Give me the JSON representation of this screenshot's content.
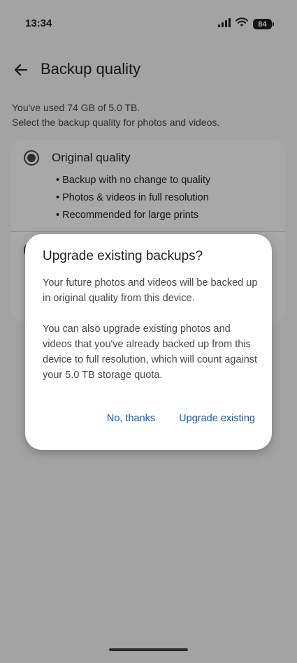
{
  "status_bar": {
    "time": "13:34",
    "battery": "84",
    "icons": [
      "signal-icon",
      "wifi-icon",
      "battery-icon"
    ]
  },
  "app_bar": {
    "title": "Backup quality",
    "back_icon": "arrow-back-icon"
  },
  "usage": {
    "line1": "You've used 74 GB of 5.0 TB.",
    "line2": "Select the backup quality for photos and videos."
  },
  "options": [
    {
      "title": "Original quality",
      "selected": true,
      "bullets": [
        "Backup with no change to quality",
        "Photos & videos in full resolution",
        "Recommended for large prints"
      ]
    }
  ],
  "dialog": {
    "title": "Upgrade existing backups?",
    "paragraph1": "Your future photos and videos will be backed up in original quality from this device.",
    "paragraph2": "You can also upgrade existing photos and videos that you've already backed up from this device to full resolution, which will count against your 5.0 TB storage quota.",
    "dismiss_label": "No, thanks",
    "confirm_label": "Upgrade existing"
  },
  "colors": {
    "accent": "#0b57d0",
    "scrim": "#000000"
  }
}
